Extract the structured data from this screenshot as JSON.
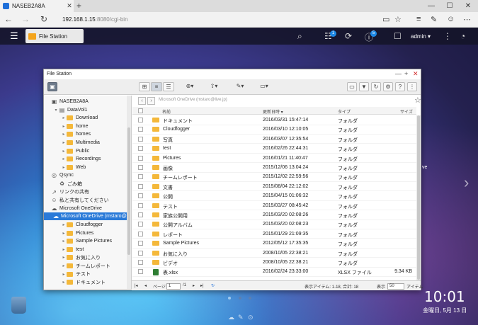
{
  "browser": {
    "tab_title": "NASEB2A8A",
    "tab_close": "✕",
    "new_tab": "+",
    "url_host": "192.168.1.15",
    "url_rest": ":8080/cgi-bin",
    "win_min": "—",
    "win_max": "☐",
    "win_close": "✕"
  },
  "nas": {
    "app_tab": "File Station",
    "badge_1": "1",
    "badge_2": "5",
    "user": "admin ▾"
  },
  "window": {
    "title": "File Station",
    "path_placeholder": "Microsoft OneDrive (mstaro@live.jp)"
  },
  "tree": [
    {
      "label": "NASEB2A8A",
      "indent": 0,
      "kind": "nas"
    },
    {
      "label": "DataVol1",
      "indent": 1,
      "kind": "vol",
      "arrow": "▾"
    },
    {
      "label": "Download",
      "indent": 2,
      "kind": "folder",
      "arrow": "▸"
    },
    {
      "label": "home",
      "indent": 2,
      "kind": "folder",
      "arrow": "▸"
    },
    {
      "label": "homes",
      "indent": 2,
      "kind": "folder",
      "arrow": "▸"
    },
    {
      "label": "Multimedia",
      "indent": 2,
      "kind": "folder",
      "arrow": "▸"
    },
    {
      "label": "Public",
      "indent": 2,
      "kind": "folder",
      "arrow": "▸"
    },
    {
      "label": "Recordings",
      "indent": 2,
      "kind": "folder",
      "arrow": "▸"
    },
    {
      "label": "Web",
      "indent": 2,
      "kind": "folder",
      "arrow": "▸"
    },
    {
      "label": "Qsync",
      "indent": 0,
      "kind": "sync"
    },
    {
      "label": "ごみ箱",
      "indent": 1,
      "kind": "trash"
    },
    {
      "label": "リンクの共有",
      "indent": 0,
      "kind": "share"
    },
    {
      "label": "私と共有してください",
      "indent": 0,
      "kind": "people"
    },
    {
      "label": "Microsoft OneDrive",
      "indent": 0,
      "kind": "cloud"
    },
    {
      "label": "Microsoft OneDrive (mstaro@live.jp)",
      "indent": 1,
      "kind": "cloud",
      "selected": true
    },
    {
      "label": "Cloudfogger",
      "indent": 2,
      "kind": "folder",
      "arrow": "▸"
    },
    {
      "label": "Pictures",
      "indent": 2,
      "kind": "folder",
      "arrow": "▸"
    },
    {
      "label": "Sample Pictures",
      "indent": 2,
      "kind": "folder",
      "arrow": "▸"
    },
    {
      "label": "test",
      "indent": 2,
      "kind": "folder",
      "arrow": "▸"
    },
    {
      "label": "お気に入り",
      "indent": 2,
      "kind": "folder",
      "arrow": "▸"
    },
    {
      "label": "チームレポート",
      "indent": 2,
      "kind": "folder",
      "arrow": "▸"
    },
    {
      "label": "テスト",
      "indent": 2,
      "kind": "folder",
      "arrow": "▸"
    },
    {
      "label": "ドキュメント",
      "indent": 2,
      "kind": "folder",
      "arrow": "▸"
    }
  ],
  "columns": {
    "name": "名前",
    "date": "更新日時 ▾",
    "type": "タイプ",
    "size": "サイズ"
  },
  "files": [
    {
      "name": "ドキュメント",
      "date": "2016/03/31 15:47:14",
      "type": "フォルダ",
      "size": ""
    },
    {
      "name": "Cloudfogger",
      "date": "2016/03/10 12:10:05",
      "type": "フォルダ",
      "size": ""
    },
    {
      "name": "写真",
      "date": "2016/03/07 12:35:54",
      "type": "フォルダ",
      "size": ""
    },
    {
      "name": "test",
      "date": "2016/02/26 22:44:31",
      "type": "フォルダ",
      "size": ""
    },
    {
      "name": "Pictures",
      "date": "2016/01/21 11:40:47",
      "type": "フォルダ",
      "size": ""
    },
    {
      "name": "画像",
      "date": "2015/12/06 13:04:24",
      "type": "フォルダ",
      "size": ""
    },
    {
      "name": "チームレポート",
      "date": "2015/12/02 22:59:56",
      "type": "フォルダ",
      "size": ""
    },
    {
      "name": "文書",
      "date": "2015/08/04 22:12:02",
      "type": "フォルダ",
      "size": ""
    },
    {
      "name": "公開",
      "date": "2015/04/15 01:06:32",
      "type": "フォルダ",
      "size": ""
    },
    {
      "name": "テスト",
      "date": "2015/03/27 08:45:42",
      "type": "フォルダ",
      "size": ""
    },
    {
      "name": "家族公開用",
      "date": "2015/03/20 02:08:26",
      "type": "フォルダ",
      "size": ""
    },
    {
      "name": "公開アルバム",
      "date": "2015/03/20 02:08:23",
      "type": "フォルダ",
      "size": ""
    },
    {
      "name": "レポート",
      "date": "2015/01/29 21:09:35",
      "type": "フォルダ",
      "size": ""
    },
    {
      "name": "Sample Pictures",
      "date": "2012/05/12 17:35:35",
      "type": "フォルダ",
      "size": ""
    },
    {
      "name": "お気に入り",
      "date": "2008/10/05 22:38:21",
      "type": "フォルダ",
      "size": ""
    },
    {
      "name": "ビデオ",
      "date": "2008/10/05 22:38:21",
      "type": "フォルダ",
      "size": ""
    },
    {
      "name": "表.xlsx",
      "date": "2016/02/24 23:33:00",
      "type": "XLSX ファイル",
      "size": "9.34 KB",
      "kind": "xlsx"
    }
  ],
  "status": {
    "page_label": "ページ",
    "page_value": "1",
    "page_total": "/1",
    "items": "表示アイテム: 1-18, 合計: 18",
    "show_label": "表示",
    "show_value": "50",
    "items_label": "アイテム"
  },
  "desktop": {
    "time": "10:01",
    "date": "金曜日, 5月 13 日",
    "stray_text": "ve"
  },
  "colors": {
    "accent": "#2a7ad8",
    "folder": "#f4b83a",
    "close": "#d32f2f"
  }
}
